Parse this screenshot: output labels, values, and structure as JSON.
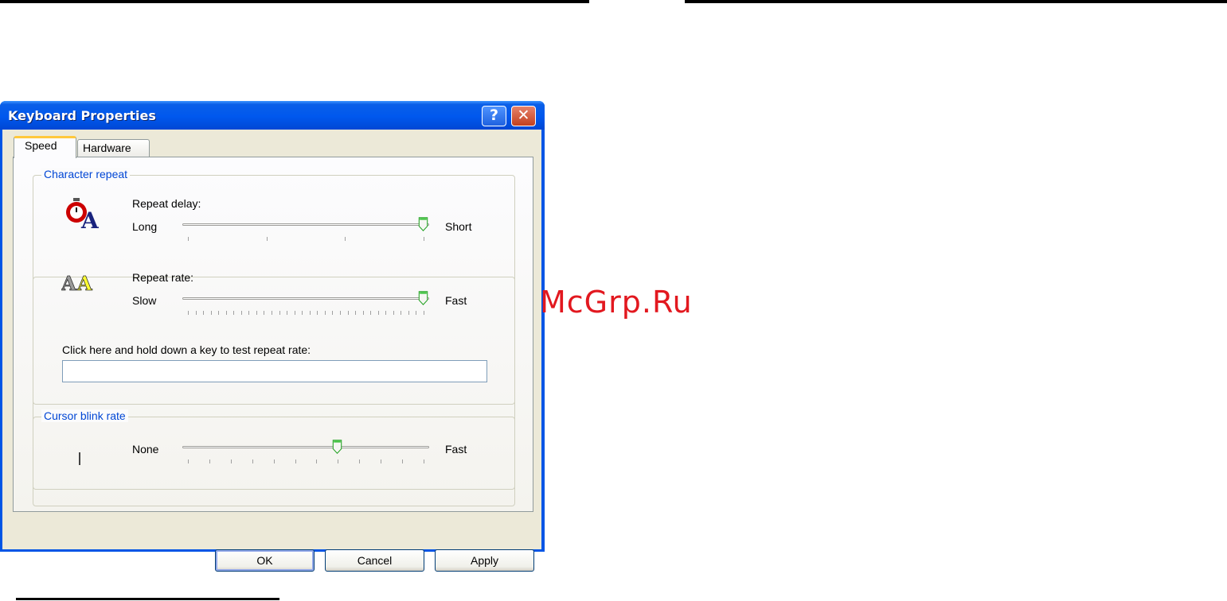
{
  "window": {
    "title": "Keyboard Properties",
    "help_glyph": "?",
    "close_glyph": "✕"
  },
  "tabs": [
    {
      "label": "Speed",
      "active": true
    },
    {
      "label": "Hardware",
      "active": false
    }
  ],
  "character_repeat": {
    "group_label": "Character repeat",
    "repeat_delay": {
      "label": "Repeat delay:",
      "min_label": "Long",
      "max_label": "Short",
      "value": 3,
      "max": 3
    },
    "repeat_rate": {
      "label": "Repeat rate:",
      "min_label": "Slow",
      "max_label": "Fast",
      "value": 31,
      "max": 31
    },
    "test": {
      "label": "Click here and hold down a key to test repeat rate:",
      "value": ""
    }
  },
  "cursor_blink": {
    "group_label": "Cursor blink rate",
    "min_label": "None",
    "max_label": "Fast",
    "value": 7,
    "max": 11
  },
  "buttons": {
    "ok": "OK",
    "cancel": "Cancel",
    "apply": "Apply"
  },
  "watermark": "McGrp.Ru",
  "colors": {
    "titlebar": "#0058ee",
    "group_label": "#0046d5",
    "watermark": "#e2181f",
    "tab_highlight": "#ffc83c"
  }
}
